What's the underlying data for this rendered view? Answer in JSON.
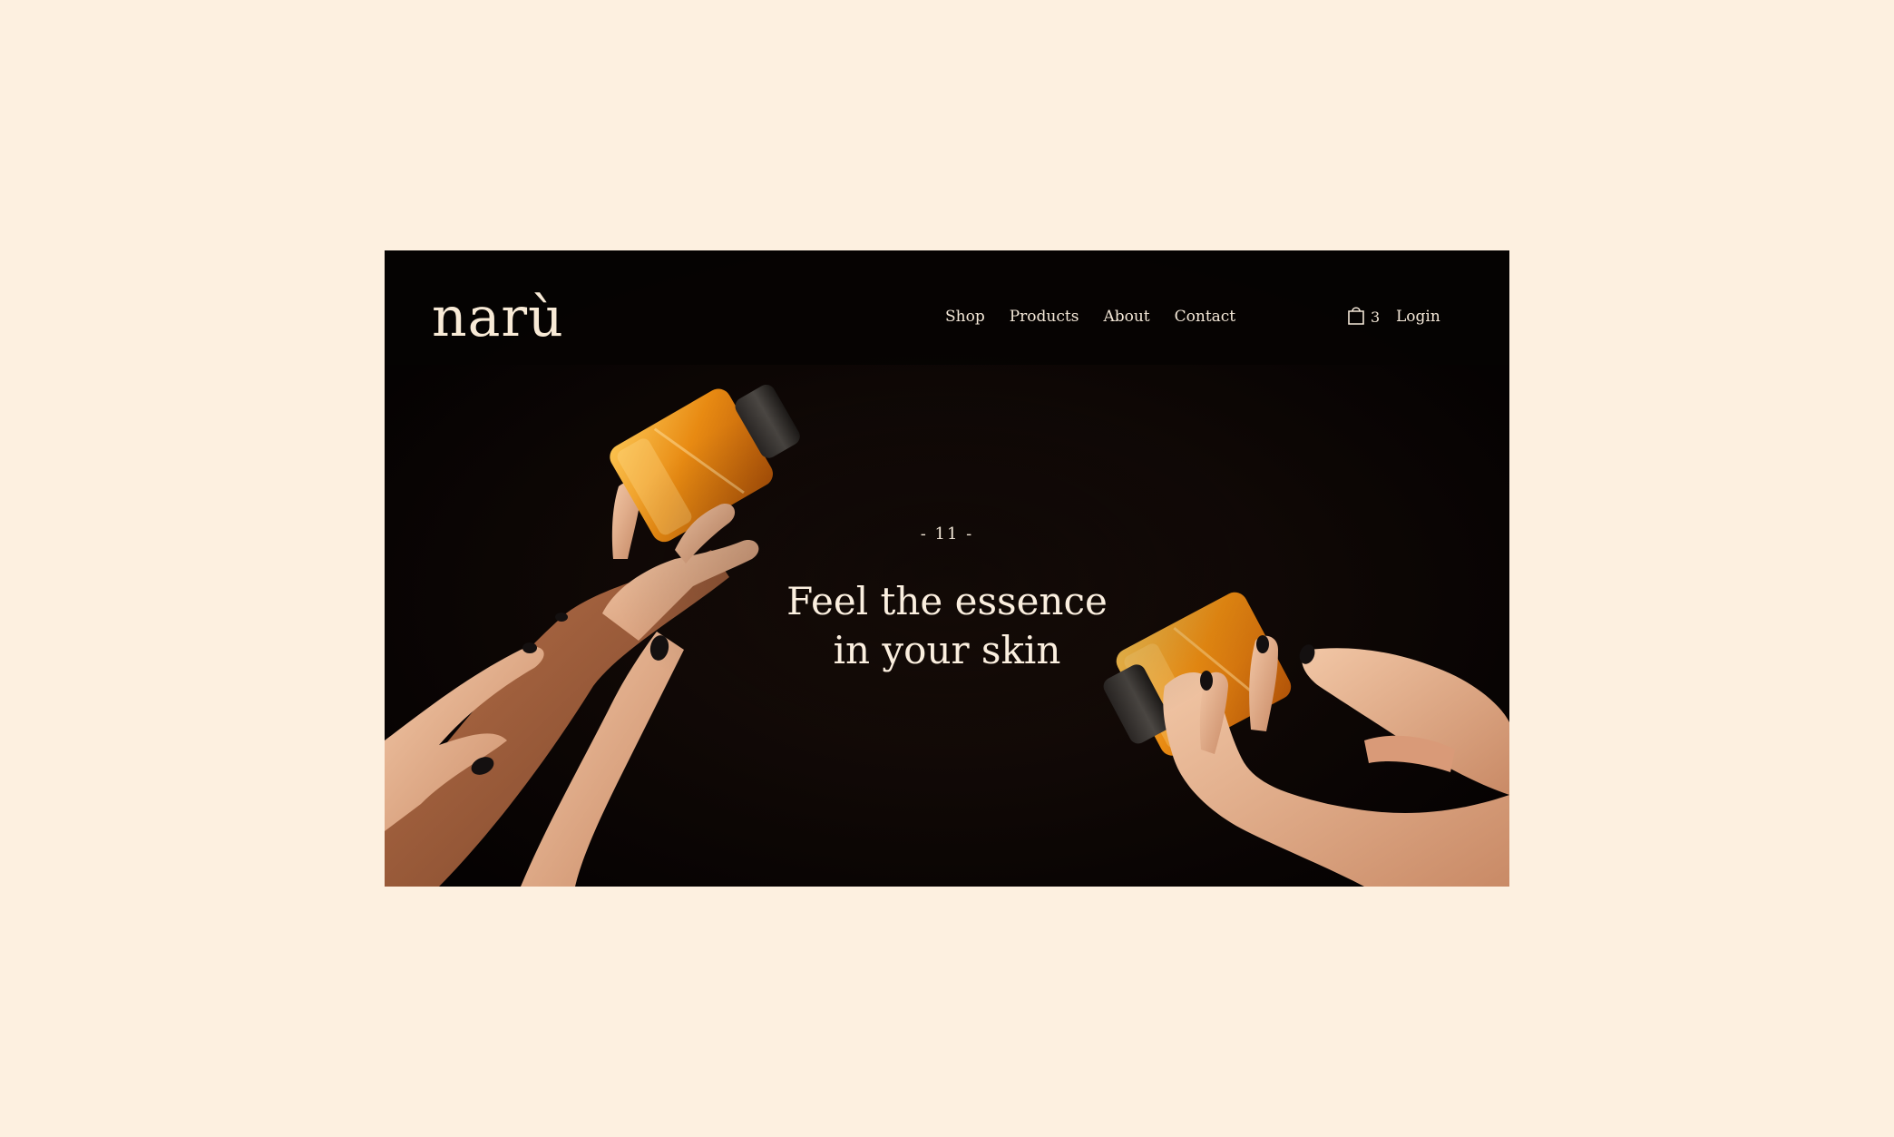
{
  "brand": {
    "logo_text": "narù"
  },
  "nav": {
    "links": [
      {
        "label": "Shop"
      },
      {
        "label": "Products"
      },
      {
        "label": "About"
      },
      {
        "label": "Contact"
      }
    ],
    "cart_count": "3",
    "login_label": "Login",
    "cart_icon": "shopping-bag-icon"
  },
  "hero": {
    "slide_number": "- 11 -",
    "title_line1": "Feel the essence",
    "title_line2": "in your skin",
    "image": "hands-holding-oil-bottles"
  },
  "colors": {
    "page_background": "#fdf0e0",
    "site_background": "#080403",
    "text_light": "#f4e8d8",
    "oil_amber": "#e89a18"
  }
}
